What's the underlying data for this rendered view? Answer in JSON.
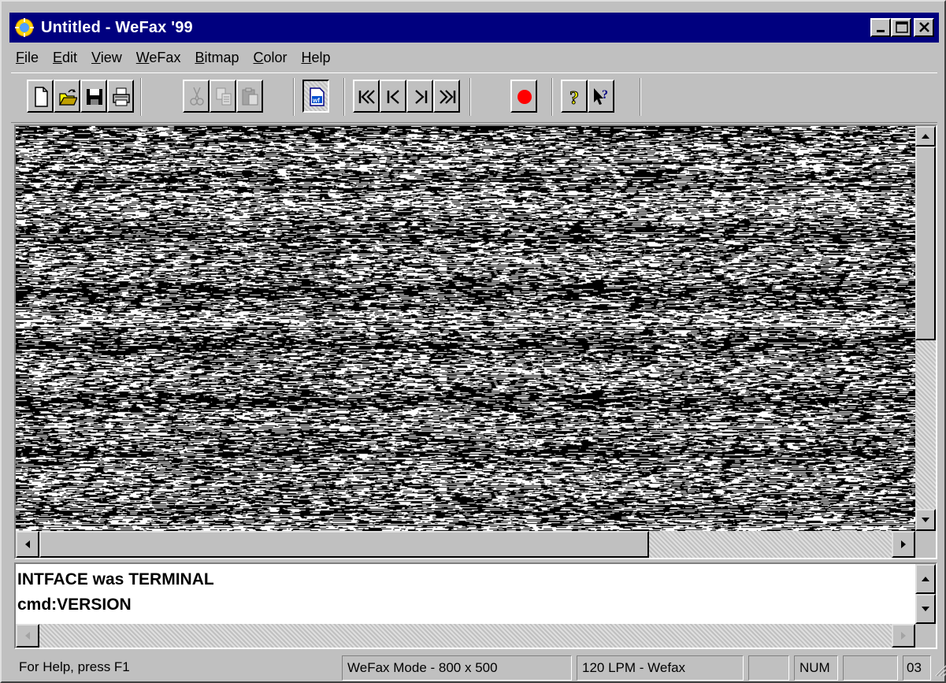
{
  "window": {
    "title": "Untitled - WeFax '99",
    "accent": "#00007f"
  },
  "menu": [
    {
      "label": "File",
      "key": "F",
      "rest": "ile"
    },
    {
      "label": "Edit",
      "key": "E",
      "rest": "dit"
    },
    {
      "label": "View",
      "key": "V",
      "rest": "iew"
    },
    {
      "label": "WeFax",
      "key": "W",
      "rest": "eFax"
    },
    {
      "label": "Bitmap",
      "key": "B",
      "rest": "itmap"
    },
    {
      "label": "Color",
      "key": "C",
      "rest": "olor"
    },
    {
      "label": "Help",
      "key": "H",
      "rest": "elp"
    }
  ],
  "toolbar": {
    "buttons": [
      "new-icon",
      "open-icon",
      "save-icon",
      "print-icon",
      "cut-icon",
      "copy-icon",
      "paste-icon",
      "wefax-icon",
      "first-icon",
      "previous-icon",
      "next-icon",
      "last-icon",
      "record-icon",
      "about-icon",
      "context-help-icon"
    ]
  },
  "image_view": {
    "fill": "#000000",
    "hscroll_position": 0.72
  },
  "terminal": {
    "lines": [
      "INTFACE was TERMINAL",
      "cmd:VERSION"
    ]
  },
  "status": {
    "help": "For Help, press F1",
    "mode": "WeFax Mode - 800 x 500",
    "lpm": "120 LPM - Wefax",
    "num": "NUM",
    "clock": "03"
  }
}
